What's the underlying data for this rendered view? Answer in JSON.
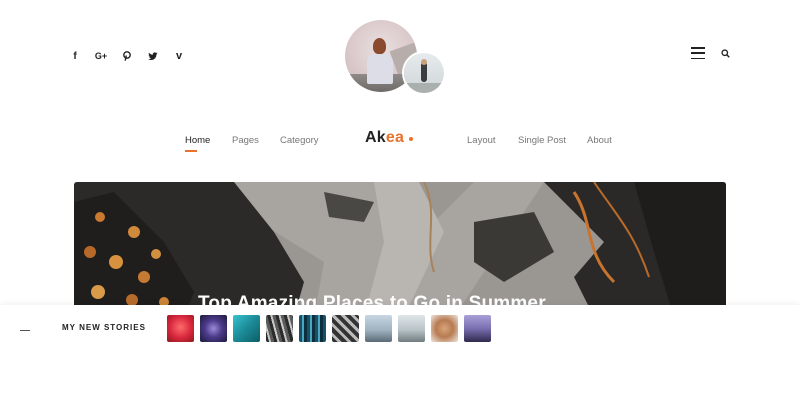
{
  "social": {
    "icons": [
      "facebook-icon",
      "google-plus-icon",
      "pinterest-icon",
      "twitter-icon",
      "vimeo-icon"
    ],
    "facebook_glyph": "f",
    "google_plus_glyph": "G+",
    "vimeo_glyph": "v"
  },
  "header": {
    "right_icons": [
      "menu-icon",
      "search-icon"
    ]
  },
  "nav": {
    "items_left": [
      "Home",
      "Pages",
      "Category"
    ],
    "items_right": [
      "Layout",
      "Single Post",
      "About"
    ],
    "active": "Home",
    "logo": {
      "prefix": "Ak",
      "accent": "ea"
    }
  },
  "hero": {
    "title": "Top Amazing Places to Go in Summer"
  },
  "stories": {
    "label": "MY NEW STORIES",
    "count": 10
  },
  "colors": {
    "accent": "#e8732c",
    "text": "#222222",
    "muted": "#777777",
    "background": "#ffffff"
  }
}
